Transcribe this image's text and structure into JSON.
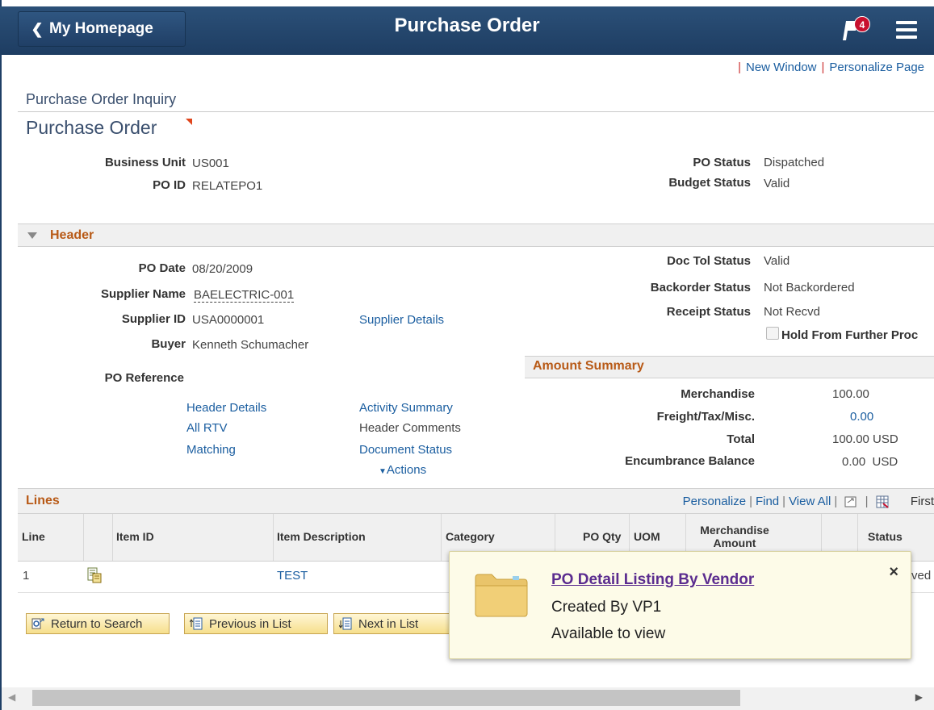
{
  "banner": {
    "home_label": "My Homepage",
    "title": "Purchase Order",
    "notification_count": "4"
  },
  "toplinks": {
    "new_window": "New Window",
    "personalize_page": "Personalize Page"
  },
  "breadcrumb": "Purchase Order Inquiry",
  "page_title": "Purchase Order",
  "key_fields": {
    "business_unit_label": "Business Unit",
    "business_unit": "US001",
    "po_id_label": "PO ID",
    "po_id": "RELATEPO1",
    "po_status_label": "PO Status",
    "po_status": "Dispatched",
    "budget_status_label": "Budget Status",
    "budget_status": "Valid"
  },
  "header": {
    "section_title": "Header",
    "po_date_label": "PO Date",
    "po_date": "08/20/2009",
    "supplier_name_label": "Supplier Name",
    "supplier_name": "BAELECTRIC-001",
    "supplier_id_label": "Supplier ID",
    "supplier_id": "USA0000001",
    "supplier_details_link": "Supplier Details",
    "buyer_label": "Buyer",
    "buyer": "Kenneth Schumacher",
    "po_reference_label": "PO Reference",
    "doc_tol_label": "Doc Tol Status",
    "doc_tol": "Valid",
    "backorder_label": "Backorder Status",
    "backorder": "Not Backordered",
    "receipt_label": "Receipt Status",
    "receipt": "Not Recvd",
    "hold_label": "Hold From Further Proc",
    "links_left": [
      "Header Details",
      "All RTV",
      "Matching"
    ],
    "links_right": [
      "Activity Summary",
      "Header Comments",
      "Document Status"
    ],
    "actions_label": "Actions"
  },
  "amount_summary": {
    "title": "Amount Summary",
    "merchandise_label": "Merchandise",
    "merchandise": "100.00",
    "freight_label": "Freight/Tax/Misc.",
    "freight": "0.00",
    "total_label": "Total",
    "total": "100.00 USD",
    "encumbrance_label": "Encumbrance Balance",
    "encumbrance": "0.00  USD"
  },
  "lines": {
    "title": "Lines",
    "nav": {
      "personalize": "Personalize",
      "find": "Find",
      "view_all": "View All",
      "first": "First"
    },
    "columns": [
      "Line",
      "Item ID",
      "Item Description",
      "Category",
      "PO Qty",
      "UOM",
      "Merchandise Amount",
      "Status"
    ],
    "row": {
      "line": "1",
      "item_id": "",
      "description": "TEST",
      "status_partial": "ved"
    }
  },
  "buttons": {
    "return": "Return to Search",
    "previous": "Previous in List",
    "next": "Next in List"
  },
  "toast": {
    "title": "PO Detail Listing By Vendor",
    "created_by": "Created By VP1",
    "availability": "Available to view",
    "close": "×"
  },
  "colors": {
    "banner": "#1e3d62",
    "section_title": "#b85a17",
    "link": "#1b5ea0",
    "badge": "#c8102e",
    "toast_bg": "#fdfbe8"
  }
}
